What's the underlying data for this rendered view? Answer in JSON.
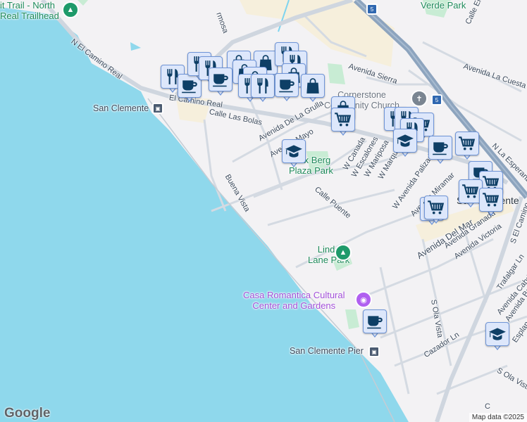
{
  "map": {
    "labels": {
      "trail": "it Trail - North\nReal Trailhead",
      "n_el_camino": "N El Camino Real",
      "el_camino": "El Camino Real",
      "san_clemente_station": "San Clemente",
      "calle_las_bolas": "Calle Las Bolas",
      "buena_vista": "Buena Vista",
      "hermosa": "rmosa",
      "verde_park": "Verde Park",
      "avenida_sierra": "Avenida Sierra",
      "avenida_la_cuesta": "Avenida La Cuesta",
      "cornerstone": "Cornerstone\nCommunity Church",
      "avenida_de_la_grulla": "Avenida De La Grulla",
      "avenida_mayo": "Avenida Mayo",
      "max_berg": "Max Berg\nPlaza Park",
      "calle_puente": "Calle Puente",
      "w_canada": "W Canada",
      "w_escalones": "W Escalones",
      "w_mariposa": "W Mariposa",
      "w_marquita": "W Marquita",
      "w_avenida_palizada": "W Avenida Palizada",
      "avenida_miramar": "Avenida Miramar",
      "n_la_esperanza": "N La Esperanza",
      "san_clemente_city": "San Clemente",
      "avenida_del_mar": "Avenida Del Mar",
      "avenida_granada": "Avenida Granada",
      "avenida_victoria": "Avenida Victoria",
      "s_el_camino": "S El Camino",
      "linda_lane": "Linda\nLane Park",
      "casa_romantica": "Casa Romantica Cultural\nCenter and Gardens",
      "san_clemente_pier": "San Clemente Pier",
      "s_ola_vista": "S Ola Vista",
      "s_ola_vista_2": "S Ola Vista",
      "cazador": "Cazador Ln",
      "trafalgar": "Trafalgar Ln",
      "avenida_cabrillo": "Avenida Cabrillo",
      "avenida_barcelona": "Avenida Barcelona",
      "esplanadita": "Esplanadita",
      "calle_el": "Calle El",
      "calle_c": "C",
      "i5": "5",
      "i5b": "5"
    },
    "logo": "Google",
    "attribution": "Map data ©2025",
    "colors": {
      "water": "#8fd8ec",
      "land": "#f3f2f4",
      "road": "#d4dae2",
      "highway": "#8da4be",
      "park": "#c8ecd4",
      "marker_bg": "#dde7fb",
      "marker_border": "#6f95d8",
      "icon": "#0e3f66"
    },
    "markers": [
      "restaurant",
      "cafe",
      "restaurant",
      "restaurant",
      "shopping",
      "shopping",
      "restaurant",
      "restaurant",
      "shopping",
      "shopping",
      "shopping",
      "cafe",
      "restaurant",
      "restaurant",
      "cafe",
      "shopping",
      "shopping",
      "grocery",
      "restaurant",
      "restaurant",
      "grocery",
      "restaurant",
      "school",
      "cafe",
      "grocery",
      "cafe",
      "grocery",
      "grocery",
      "grocery",
      "grocery",
      "grocery",
      "school",
      "cafe",
      "school"
    ]
  }
}
